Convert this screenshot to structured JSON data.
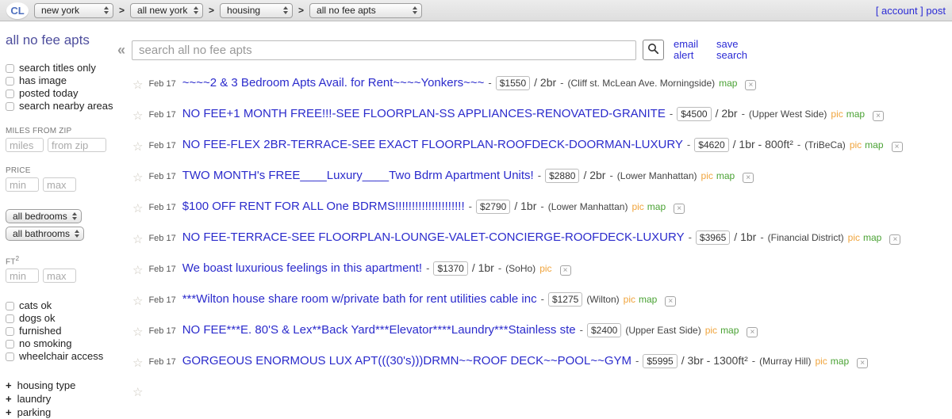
{
  "colors": {
    "link_blue": "#2b2bcc",
    "heading_purple": "#4e4e9d",
    "pic_orange": "#f0a43c",
    "map_green": "#4aa234"
  },
  "icons": {
    "star": "☆",
    "collapse": "«",
    "dismiss": "×"
  },
  "topbar": {
    "logo": "CL",
    "sep": ">",
    "selects": [
      "new york",
      "all new york",
      "housing",
      "all no fee apts"
    ],
    "account_label": "[ account ]",
    "post_label": "post"
  },
  "sidebar": {
    "title": "all no fee apts",
    "checkboxes_top": [
      "search titles only",
      "has image",
      "posted today",
      "search nearby areas"
    ],
    "miles_label": "MILES FROM ZIP",
    "miles_placeholder": "miles",
    "zip_placeholder": "from zip",
    "price_label": "PRICE",
    "min_placeholder": "min",
    "max_placeholder": "max",
    "bedrooms_select": "all bedrooms",
    "bathrooms_select": "all bathrooms",
    "ft_label": "FT",
    "ft_sup": "2",
    "checkboxes_bottom": [
      "cats ok",
      "dogs ok",
      "furnished",
      "no smoking",
      "wheelchair access"
    ],
    "plus": "+",
    "expanders": [
      "housing type",
      "laundry",
      "parking"
    ]
  },
  "search": {
    "placeholder": "search all no fee apts",
    "email_alert_label": "email alert",
    "save_search_label": "save search"
  },
  "listings": {
    "sep": "-",
    "rows": [
      {
        "date": "Feb 17",
        "title": "~~~~2 & 3 Bedroom Apts Avail. for Rent~~~~Yonkers~~~",
        "price": "$1550",
        "bed": "2br",
        "hood": "(Cliff st. McLean Ave. Morningside)",
        "links": [
          "map"
        ]
      },
      {
        "date": "Feb 17",
        "title": "NO FEE+1 MONTH FREE!!!-SEE FLOORPLAN-SS APPLIANCES-RENOVATED-GRANITE",
        "price": "$4500",
        "bed": "2br",
        "hood": "(Upper West Side)",
        "links": [
          "pic",
          "map"
        ]
      },
      {
        "date": "Feb 17",
        "title": "NO FEE-FLEX 2BR-TERRACE-SEE EXACT FLOORPLAN-ROOFDECK-DOORMAN-LUXURY",
        "price": "$4620",
        "bed": "1br - 800ft²",
        "hood": "(TriBeCa)",
        "links": [
          "pic",
          "map"
        ]
      },
      {
        "date": "Feb 17",
        "title": "TWO MONTH's FREE____Luxury____Two Bdrm Apartment Units!",
        "price": "$2880",
        "bed": "2br",
        "hood": "(Lower Manhattan)",
        "links": [
          "pic",
          "map"
        ]
      },
      {
        "date": "Feb 17",
        "title": "$100 OFF RENT FOR ALL One BDRMS!!!!!!!!!!!!!!!!!!!!!",
        "price": "$2790",
        "bed": "1br",
        "hood": "(Lower Manhattan)",
        "links": [
          "pic",
          "map"
        ]
      },
      {
        "date": "Feb 17",
        "title": "NO FEE-TERRACE-SEE FLOORPLAN-LOUNGE-VALET-CONCIERGE-ROOFDECK-LUXURY",
        "price": "$3965",
        "bed": "1br",
        "hood": "(Financial District)",
        "links": [
          "pic",
          "map"
        ]
      },
      {
        "date": "Feb 17",
        "title": "We boast luxurious feelings in this apartment!",
        "price": "$1370",
        "bed": "1br",
        "hood": "(SoHo)",
        "links": [
          "pic"
        ]
      },
      {
        "date": "Feb 17",
        "title": "***Wilton house share room w/private bath for rent utilities cable inc",
        "price": "$1275",
        "bed": "",
        "hood": "(Wilton)",
        "links": [
          "pic",
          "map"
        ]
      },
      {
        "date": "Feb 17",
        "title": "NO FEE***E. 80'S & Lex**Back Yard***Elevator****Laundry***Stainless ste",
        "price": "$2400",
        "bed": "",
        "hood": "(Upper East Side)",
        "links": [
          "pic",
          "map"
        ]
      },
      {
        "date": "Feb 17",
        "title": "GORGEOUS ENORMOUS LUX APT(((30's)))DRMN~~ROOF DECK~~POOL~~GYM",
        "price": "$5995",
        "bed": "3br - 1300ft²",
        "hood": "(Murray Hill)",
        "links": [
          "pic",
          "map"
        ]
      }
    ]
  }
}
